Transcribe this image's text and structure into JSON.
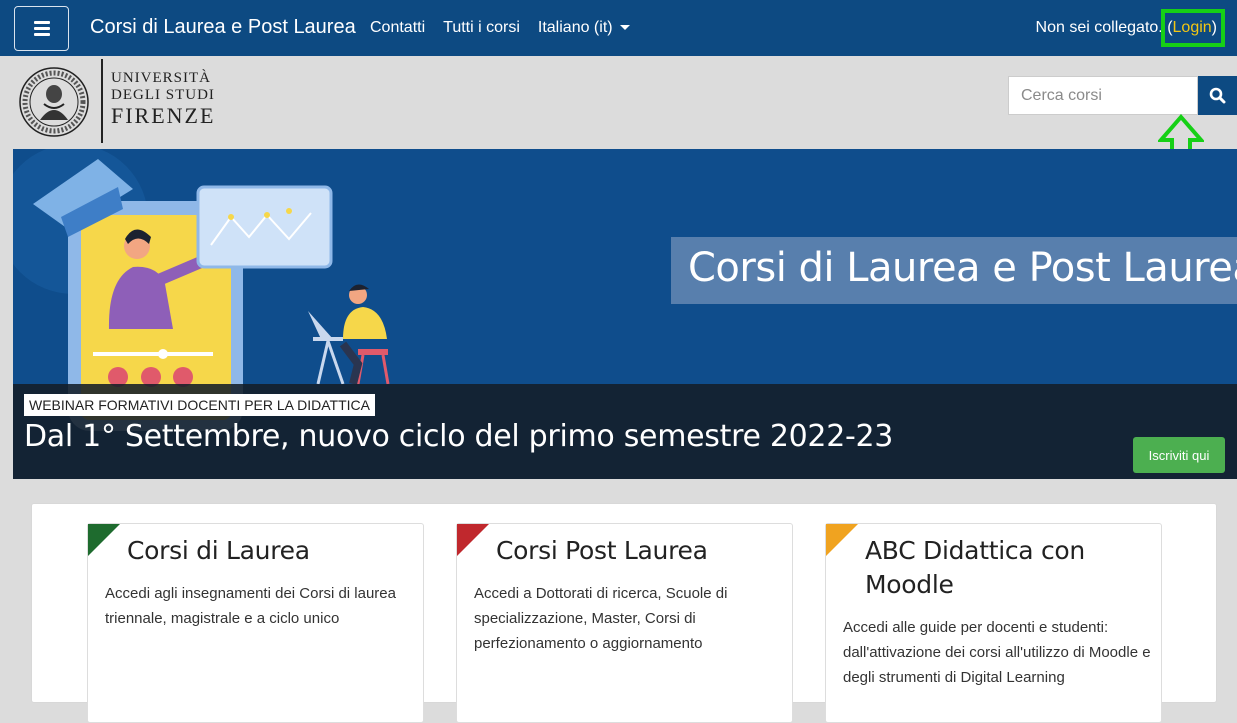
{
  "navbar": {
    "menu_icon": "hamburger-icon",
    "brand": "Corsi di Laurea e Post Laurea",
    "links": [
      "Contatti",
      "Tutti i corsi",
      "Italiano (it)"
    ],
    "not_logged": "Non sei collegato.",
    "login_open": "(",
    "login_label": "Login",
    "login_close": ")"
  },
  "header": {
    "logo_line1": "UNIVERSITÀ",
    "logo_line2": "DEGLI STUDI",
    "logo_line3": "FIRENZE",
    "search_placeholder": "Cerca corsi",
    "search_icon": "search-icon"
  },
  "hero": {
    "title": "Corsi di Laurea e Post Laurea",
    "caption_tag": "WEBINAR FORMATIVI DOCENTI PER LA DIDATTICA",
    "caption_text": "Dal 1° Settembre, nuovo ciclo del primo semestre 2022-23",
    "button": "Iscriviti qui"
  },
  "cards": [
    {
      "title": "Corsi di Laurea",
      "desc": "Accedi agli insegnamenti dei Corsi di laurea triennale, magistrale e a ciclo unico",
      "color": "#1e6b2e"
    },
    {
      "title": "Corsi Post Laurea",
      "desc": "Accedi a Dottorati di ricerca, Scuole di specializzazione, Master, Corsi di perfezionamento o aggiornamento",
      "color": "#c0282d"
    },
    {
      "title": "ABC Didattica con Moodle",
      "desc": "Accedi alle guide per docenti e studenti: dall'attivazione dei corsi all'utilizzo di Moodle e degli strumenti di Digital Learning",
      "color": "#f0a320"
    }
  ],
  "colors": {
    "navbar": "#0d4a82",
    "login": "#f3c613",
    "highlight": "#16d016",
    "button": "#4caf50"
  }
}
